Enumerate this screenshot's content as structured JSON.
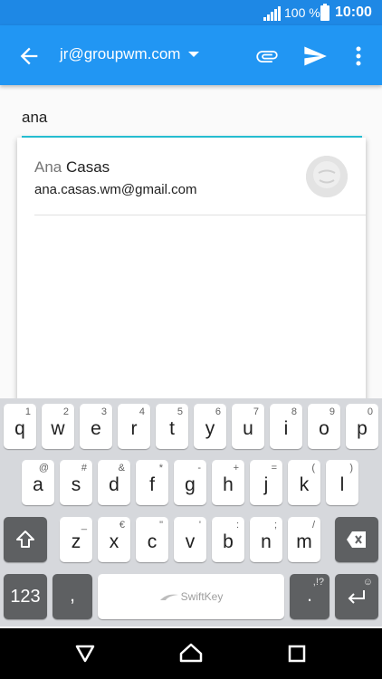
{
  "status_bar": {
    "battery_percent": "100 %",
    "time": "10:00",
    "signal_icon": "signal-icon",
    "battery_icon": "battery-icon"
  },
  "toolbar": {
    "account": "jr@groupwm.com",
    "icons": [
      "back-arrow-icon",
      "chevron-down-icon",
      "attach-icon",
      "send-icon",
      "more-vert-icon"
    ]
  },
  "to_field": {
    "value": "ana"
  },
  "suggestions": [
    {
      "name_match": "Ana",
      "name_rest": " Casas",
      "email": "ana.casas.wm@gmail.com"
    }
  ],
  "keyboard": {
    "row1": [
      {
        "main": "q",
        "alt": "1"
      },
      {
        "main": "w",
        "alt": "2"
      },
      {
        "main": "e",
        "alt": "3"
      },
      {
        "main": "r",
        "alt": "4"
      },
      {
        "main": "t",
        "alt": "5"
      },
      {
        "main": "y",
        "alt": "6"
      },
      {
        "main": "u",
        "alt": "7"
      },
      {
        "main": "i",
        "alt": "8"
      },
      {
        "main": "o",
        "alt": "9"
      },
      {
        "main": "p",
        "alt": "0"
      }
    ],
    "row2": [
      {
        "main": "a",
        "alt": "@"
      },
      {
        "main": "s",
        "alt": "#"
      },
      {
        "main": "d",
        "alt": "&"
      },
      {
        "main": "f",
        "alt": "*"
      },
      {
        "main": "g",
        "alt": "-"
      },
      {
        "main": "h",
        "alt": "+"
      },
      {
        "main": "j",
        "alt": "="
      },
      {
        "main": "k",
        "alt": "("
      },
      {
        "main": "l",
        "alt": ")"
      }
    ],
    "row3": [
      {
        "main": "z",
        "alt": "_"
      },
      {
        "main": "x",
        "alt": "€"
      },
      {
        "main": "c",
        "alt": "\""
      },
      {
        "main": "v",
        "alt": "'"
      },
      {
        "main": "b",
        "alt": ":"
      },
      {
        "main": "n",
        "alt": ";"
      },
      {
        "main": "m",
        "alt": "/"
      }
    ],
    "numbers_key": "123",
    "comma_key": ",",
    "space_label": "SwiftKey",
    "period_key": ".",
    "period_alt": ",!?",
    "enter_alt": "☺"
  }
}
